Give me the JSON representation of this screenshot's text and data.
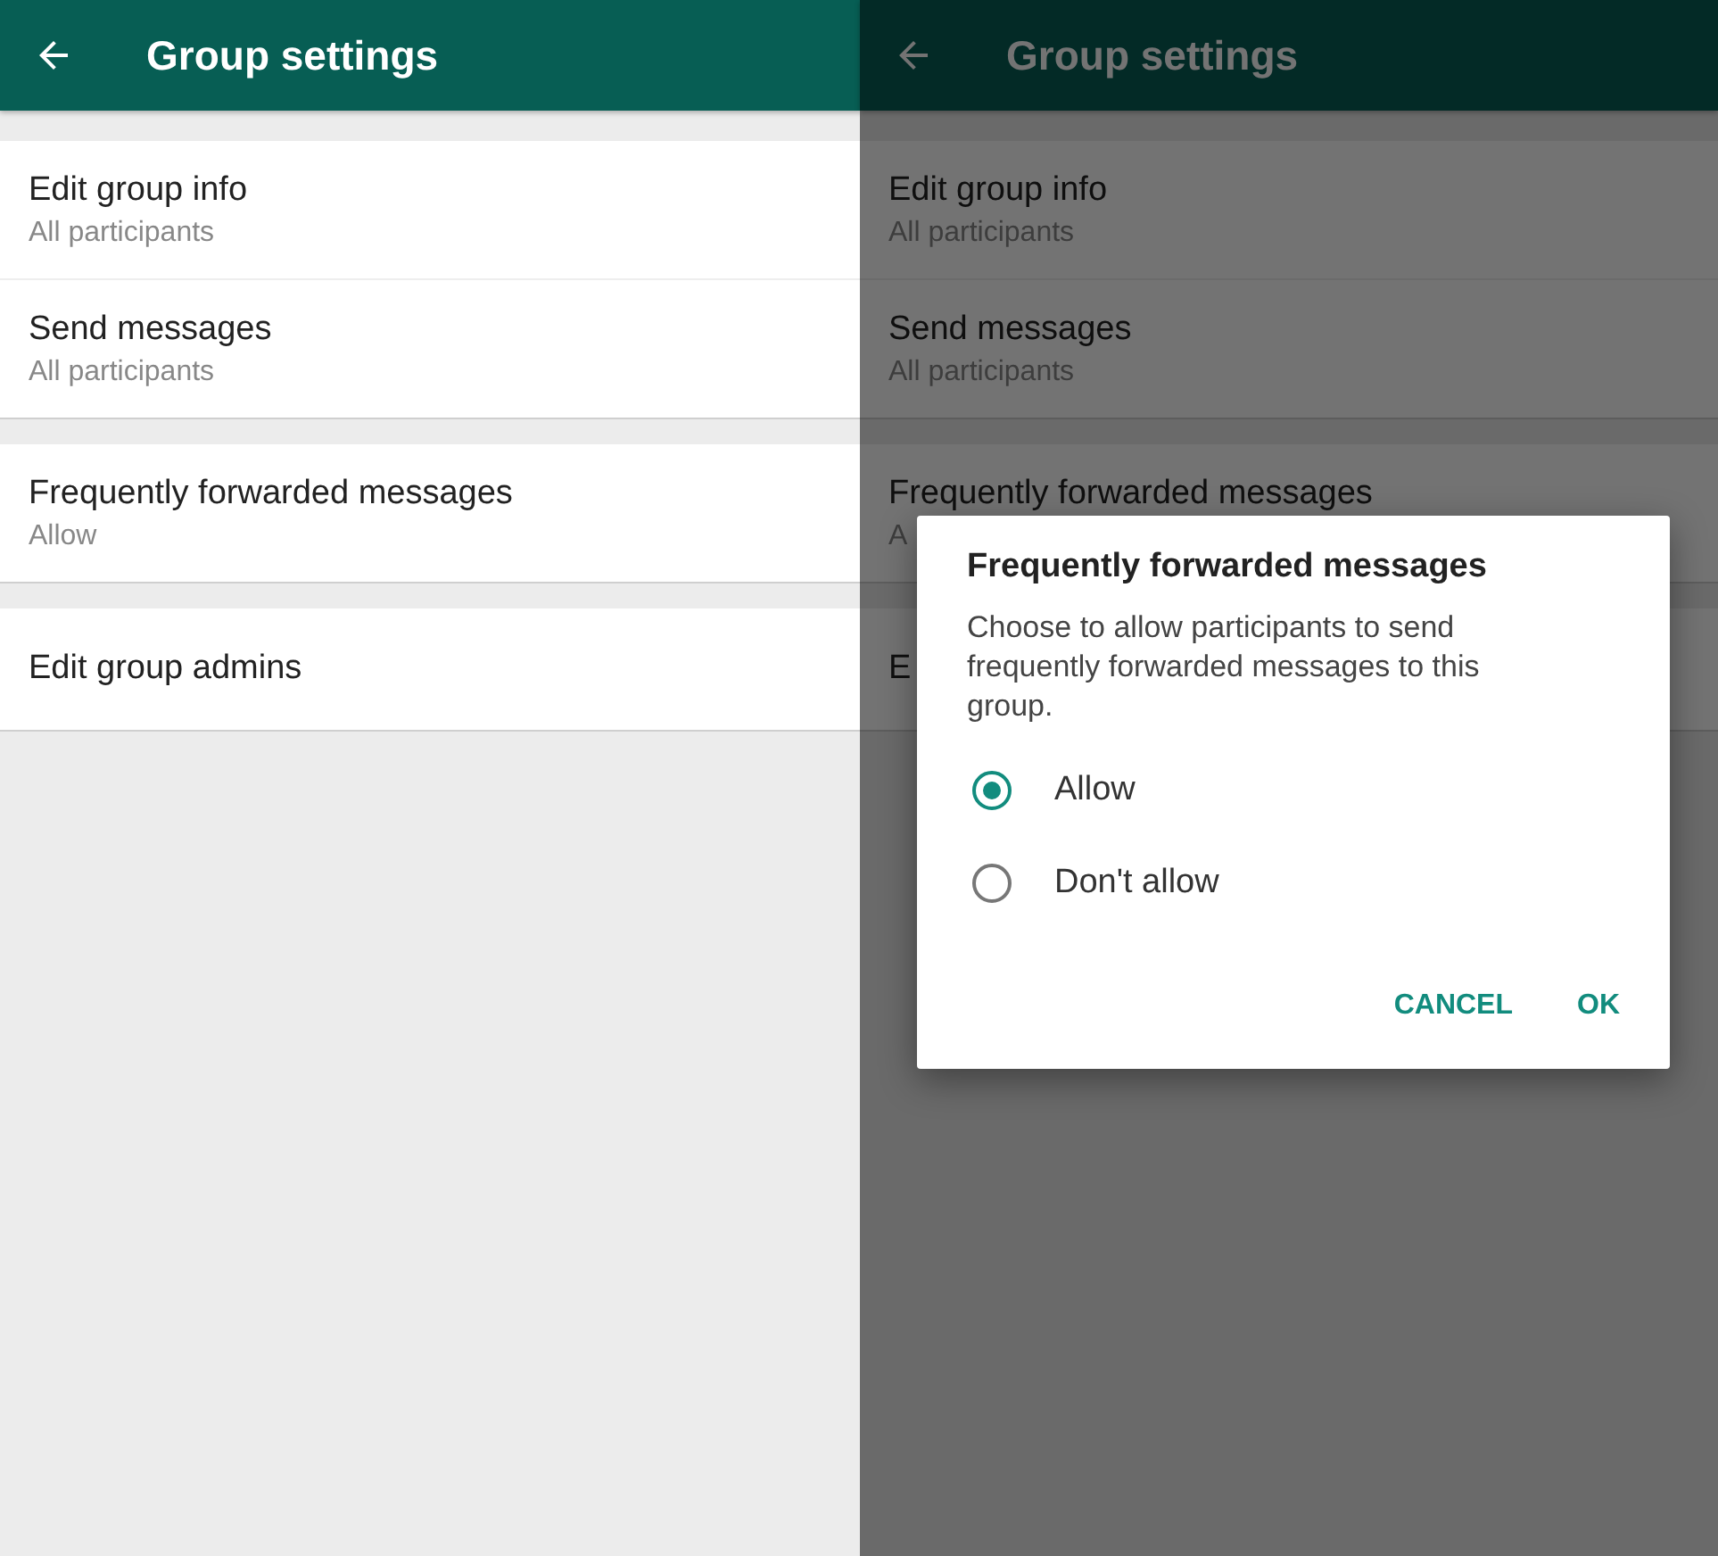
{
  "screens": [
    {
      "title": "Group settings",
      "dimmed": false,
      "sections": [
        [
          {
            "title": "Edit group info",
            "subtitle": "All participants"
          },
          {
            "title": "Send messages",
            "subtitle": "All participants"
          }
        ],
        [
          {
            "title": "Frequently forwarded messages",
            "subtitle": "Allow"
          }
        ],
        [
          {
            "title": "Edit group admins"
          }
        ]
      ]
    },
    {
      "title": "Group settings",
      "dimmed": true,
      "sections": [
        [
          {
            "title": "Edit group info",
            "subtitle": "All participants"
          },
          {
            "title": "Send messages",
            "subtitle": "All participants"
          }
        ],
        [
          {
            "title": "Frequently forwarded messages",
            "subtitle": "A"
          }
        ],
        [
          {
            "title": "E"
          }
        ]
      ],
      "dialog": {
        "title": "Frequently forwarded messages",
        "message": "Choose to allow participants to send frequently forwarded messages to this group.",
        "options": [
          {
            "label": "Allow",
            "selected": true
          },
          {
            "label": "Don't allow",
            "selected": false
          }
        ],
        "buttons": [
          "CANCEL",
          "OK"
        ]
      }
    }
  ]
}
